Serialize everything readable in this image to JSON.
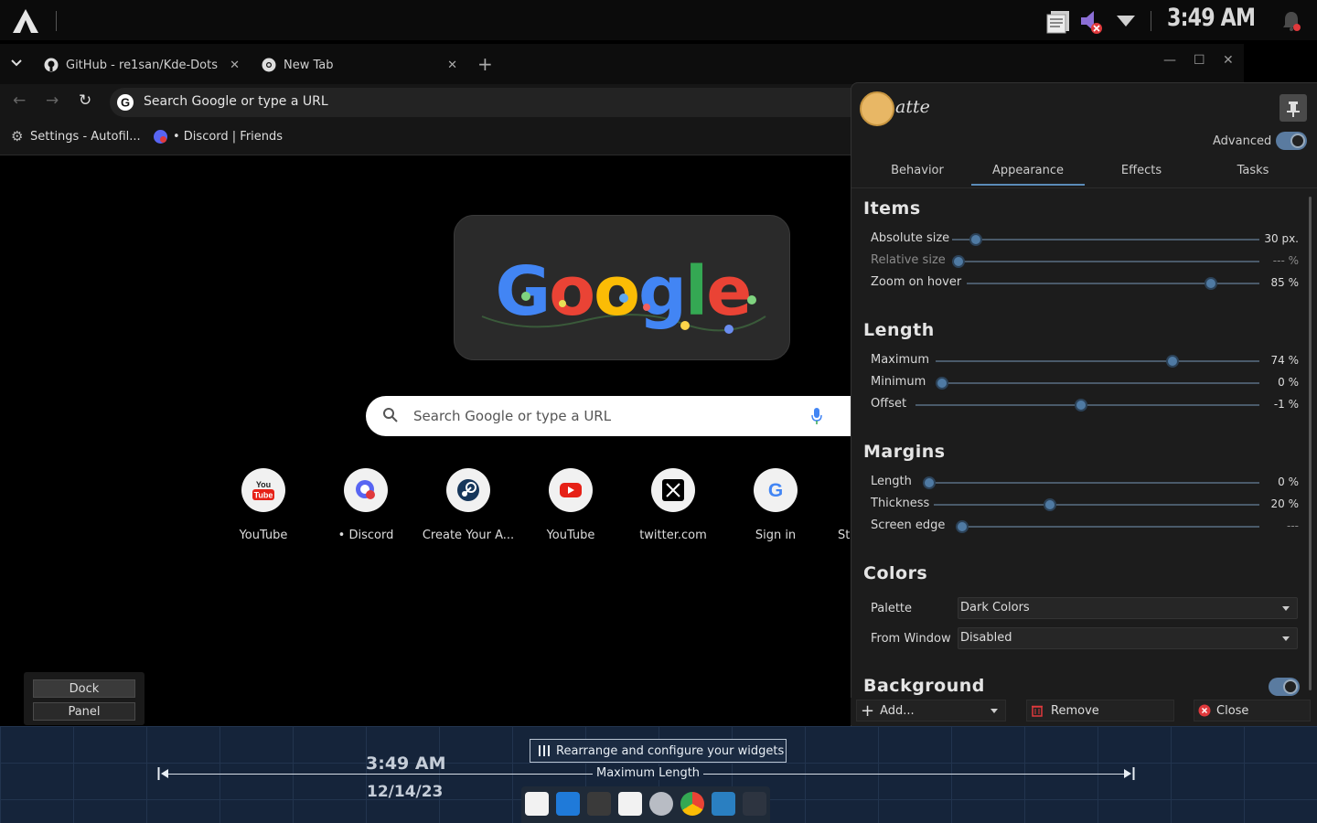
{
  "top_panel": {
    "clock": "3:49 AM"
  },
  "browser": {
    "tabs": [
      {
        "label": "GitHub - re1san/Kde-Dots"
      },
      {
        "label": "New Tab"
      }
    ],
    "new_tab_glyph": "+",
    "omnibox_placeholder": "Search Google or type a URL",
    "bookmarks": [
      {
        "label": "Settings - Autofil..."
      },
      {
        "label": "• Discord | Friends"
      }
    ],
    "search_placeholder": "Search Google or type a URL",
    "shortcuts": [
      {
        "label": "YouTube",
        "icon": "youtube-logo-icon"
      },
      {
        "label": "• Discord",
        "icon": "discord-icon"
      },
      {
        "label": "Create Your A...",
        "icon": "steam-icon"
      },
      {
        "label": "YouTube",
        "icon": "youtube-play-icon"
      },
      {
        "label": "twitter.com",
        "icon": "x-logo-icon"
      },
      {
        "label": "Sign in",
        "icon": "google-g-icon"
      },
      {
        "label": "Ste",
        "icon": "steam-icon"
      }
    ]
  },
  "layout_popup": {
    "dock_label": "Dock",
    "panel_label": "Panel"
  },
  "latte": {
    "wordmark": "atte",
    "advanced_label": "Advanced",
    "advanced_on": true,
    "tabs": [
      "Behavior",
      "Appearance",
      "Effects",
      "Tasks"
    ],
    "active_tab": "Appearance",
    "sections": {
      "items": {
        "title": "Items",
        "rows": [
          {
            "label": "Absolute size",
            "value": "30 px.",
            "level": 0.06
          },
          {
            "label": "Relative size",
            "value": "--- %",
            "level": 0.0
          },
          {
            "label": "Zoom on hover",
            "value": "85 %",
            "level": 0.85
          }
        ]
      },
      "length": {
        "title": "Length",
        "rows": [
          {
            "label": "Maximum",
            "value": "74 %",
            "level": 0.74
          },
          {
            "label": "Minimum",
            "value": "0 %",
            "level": 0.0
          },
          {
            "label": "Offset",
            "value": "-1 %",
            "level": 0.48
          }
        ]
      },
      "margins": {
        "title": "Margins",
        "rows": [
          {
            "label": "Length",
            "value": "0 %",
            "level": 0.0
          },
          {
            "label": "Thickness",
            "value": "20 %",
            "level": 0.35
          },
          {
            "label": "Screen edge",
            "value": "---",
            "level": 0.0
          }
        ]
      },
      "colors": {
        "title": "Colors",
        "palette_label": "Palette",
        "palette_value": "Dark Colors",
        "from_window_label": "From Window",
        "from_window_value": "Disabled"
      },
      "background": {
        "title": "Background",
        "enabled": true
      }
    },
    "footer": {
      "add_label": "Add...",
      "remove_label": "Remove",
      "close_label": "Close"
    }
  },
  "dock_editor": {
    "rearrange_label": "Rearrange and configure your widgets",
    "max_length_label": "Maximum Length",
    "clock": "3:49 AM",
    "date": "12/14/23"
  }
}
